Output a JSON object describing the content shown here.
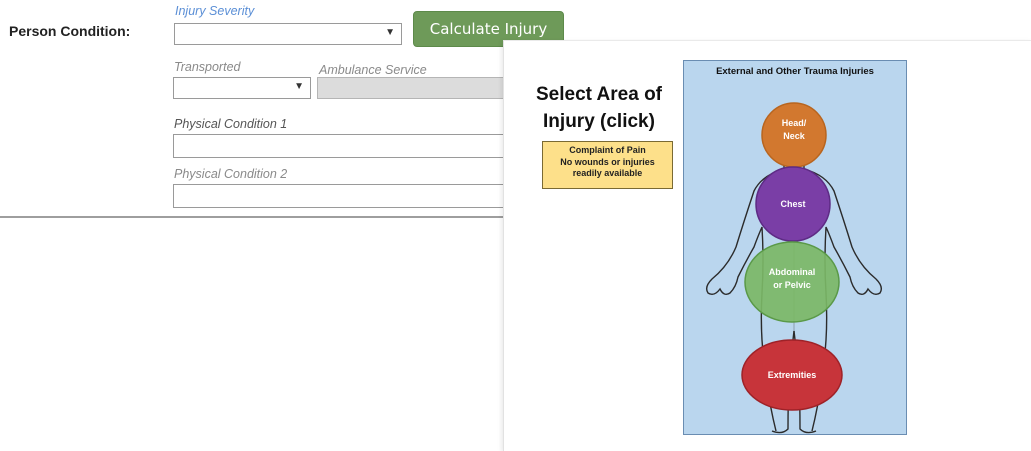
{
  "form": {
    "person_condition_label": "Person Condition:",
    "injury_severity_label": "Injury Severity",
    "injury_severity_value": "",
    "calculate_button_label": "Calculate Injury",
    "transported_label": "Transported",
    "transported_value": "",
    "ambulance_service_label": "Ambulance Service",
    "physical_condition_1_label": "Physical Condition 1",
    "physical_condition_1_value": "",
    "physical_condition_2_label": "Physical Condition 2",
    "physical_condition_2_value": ""
  },
  "popup": {
    "title": "Select Area of Injury (click)",
    "note_line1": "Complaint of Pain",
    "note_line2": "No wounds or injuries",
    "note_line3": "readily available",
    "panel_title": "External and Other Trauma Injuries",
    "zones": {
      "head_line1": "Head/",
      "head_line2": "Neck",
      "chest": "Chest",
      "abdominal_line1": "Abdominal",
      "abdominal_line2": "or Pelvic",
      "extremities": "Extremities"
    }
  },
  "colors": {
    "button_green": "#6e9a59",
    "head_orange": "#d2782f",
    "chest_purple": "#7a3ea6",
    "abdominal_green": "#7bb766",
    "extremities_red": "#c7343a",
    "note_yellow": "#fde08a",
    "panel_blue": "#bad6ee"
  }
}
